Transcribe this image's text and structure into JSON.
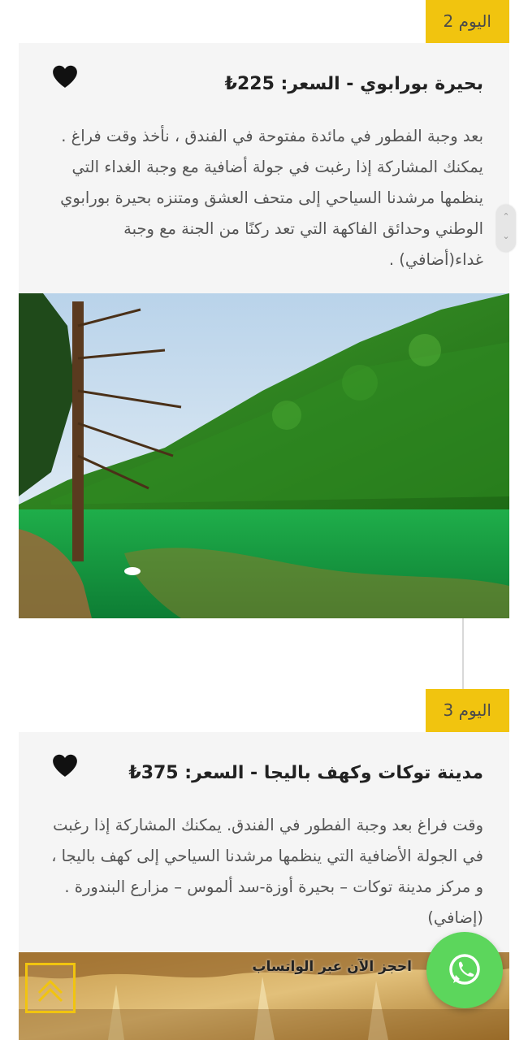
{
  "colors": {
    "accent": "#f1c40f",
    "whatsapp": "#5cd65c",
    "card_background": "#f5f5f5"
  },
  "days": [
    {
      "tag": "اليوم 2",
      "title": "بحيرة بورابوي - السعر: 225₺",
      "favorite_icon": "heart-icon",
      "description": "بعد وجبة الفطور في مائدة مفتوحة في الفندق ، نأخذ وقت فراغ . يمكنك المشاركة إذا رغبت في جولة أضافية مع وجبة الغداء التي ينظمها مرشدنا السياحي إلى متحف العشق ومتنزه بحيرة بورابوي الوطني وحدائق الفاكهة التي تعد ركنًا من الجنة مع وجبة غداء(أضافي) .",
      "image": "lake-forest-photo"
    },
    {
      "tag": "اليوم 3",
      "title": "مدينة توكات وكهف باليجا - السعر: 375₺",
      "favorite_icon": "heart-icon",
      "description": "وقت فراغ بعد وجبة الفطور في الفندق. يمكنك المشاركة إذا رغبت في الجولة الأضافية التي ينظمها مرشدنا السياحي إلى كهف باليجا ، و مركز مدينة توكات – بحيرة أوزة-سد ألموس – مزارع البندورة .(إضافي)",
      "image": "cave-photo"
    }
  ],
  "whatsapp": {
    "label": "احجز الآن عبر الواتساب",
    "icon": "whatsapp-icon"
  },
  "scroll_top": {
    "icon": "chevron-up-icon"
  },
  "scroll_indicator": {
    "up_icon": "chevron-up-icon",
    "down_icon": "chevron-down-icon"
  }
}
